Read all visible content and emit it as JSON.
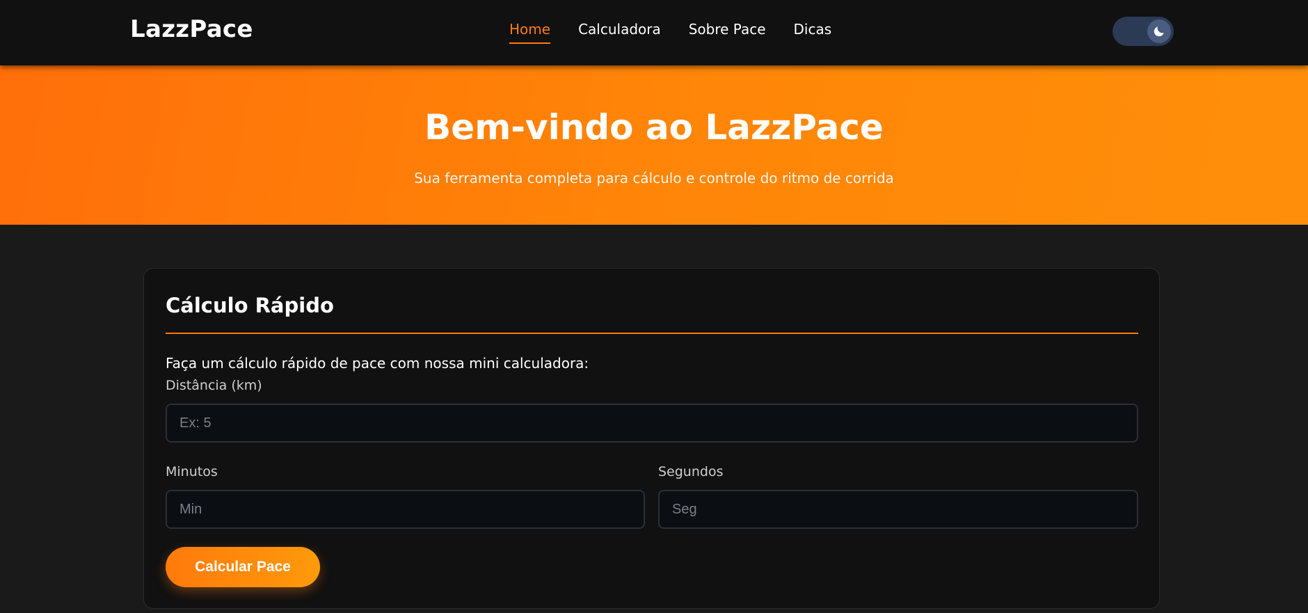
{
  "header": {
    "logo": "LazzPace",
    "nav": [
      {
        "label": "Home",
        "active": true
      },
      {
        "label": "Calculadora",
        "active": false
      },
      {
        "label": "Sobre Pace",
        "active": false
      },
      {
        "label": "Dicas",
        "active": false
      }
    ],
    "theme_toggle": {
      "icon": "moon-icon",
      "mode": "dark"
    }
  },
  "hero": {
    "title": "Bem-vindo ao LazzPace",
    "subtitle": "Sua ferramenta completa para cálculo e controle do ritmo de corrida"
  },
  "quick_calc": {
    "title": "Cálculo Rápido",
    "intro": "Faça um cálculo rápido de pace com nossa mini calculadora:",
    "distance": {
      "label": "Distância (km)",
      "placeholder": "Ex: 5",
      "value": ""
    },
    "minutes": {
      "label": "Minutos",
      "placeholder": "Min",
      "value": ""
    },
    "seconds": {
      "label": "Segundos",
      "placeholder": "Seg",
      "value": ""
    },
    "button_label": "Calcular Pace"
  },
  "colors": {
    "accent": "#ff7a10",
    "navbar_bg": "#111111",
    "page_bg": "#1a1a1a",
    "card_bg": "#111111",
    "input_bg": "#0b0e13",
    "toggle_bg": "#2b3a55"
  }
}
